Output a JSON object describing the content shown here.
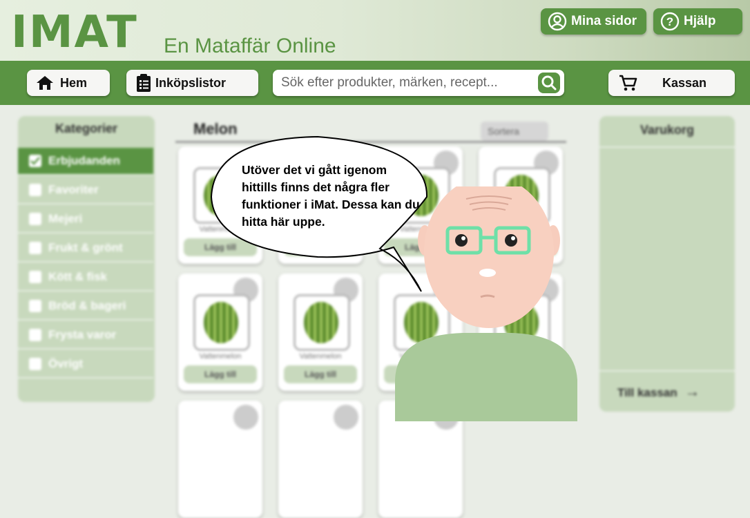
{
  "header": {
    "logo": "IMAT",
    "tagline": "En Mataffär Online",
    "mina_sidor": "Mina sidor",
    "hjalp": "Hjälp"
  },
  "nav": {
    "hem": "Hem",
    "inkopslistor": "Inköpslistor",
    "search_placeholder": "Sök efter produkter, märken, recept...",
    "kassan": "Kassan"
  },
  "sidebar": {
    "title": "Kategorier",
    "items": [
      {
        "label": "Erbjudanden",
        "checked": true
      },
      {
        "label": "Favoriter",
        "checked": false
      },
      {
        "label": "Mejeri",
        "checked": false
      },
      {
        "label": "Frukt & grönt",
        "checked": false
      },
      {
        "label": "Kött & fisk",
        "checked": false
      },
      {
        "label": "Bröd & bageri",
        "checked": false
      },
      {
        "label": "Frysta varor",
        "checked": false
      },
      {
        "label": "Övrigt",
        "checked": false
      }
    ]
  },
  "main": {
    "title": "Melon",
    "sort_label": "Sortera",
    "product_name": "Vattenmelon",
    "add_label": "Lägg till"
  },
  "cart": {
    "title": "Varukorg",
    "checkout": "Till kassan"
  },
  "guide": {
    "speech": "Utöver det vi gått igenom hittills finns det några fler funktioner i iMat. Dessa kan du hitta här uppe."
  },
  "colors": {
    "brand_green": "#5a9443",
    "light_green": "#c8d9bd",
    "glasses": "#6ee0a8"
  }
}
